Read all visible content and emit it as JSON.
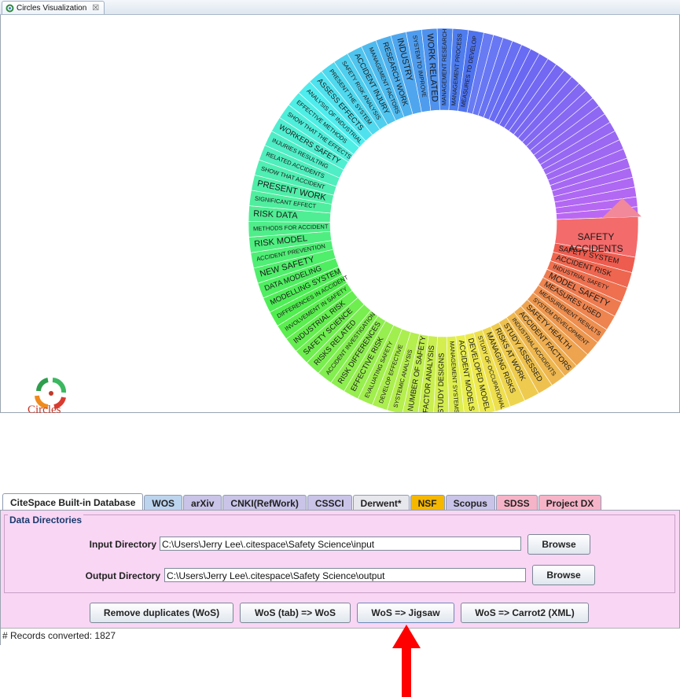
{
  "viz_window": {
    "tab_title": "Circles Visualization",
    "tab_close": "☒",
    "logo_text": "Circles"
  },
  "circle": {
    "highlight_label": [
      "SAFETY",
      "ACCIDENTS"
    ],
    "highlight_color": "#f46b6b",
    "segments": [
      "SAFETY SYSTEM",
      "ACCIDENT RISK",
      "INDUSTRIAL SAFETY",
      "MODEL SAFETY",
      "MEASURES USED",
      "MEASUREMENT RESULTS",
      "SYSTEM DEVELOPMENT",
      "SAFETY HEALTH",
      "ACCIDENT FACTORS",
      "INDUSTRIAL ACCIDENTS",
      "STUDY ASSESSED",
      "RISKS AT WORK",
      "MANAGING RISKS",
      "STUDY OF OCCUPATIONAL",
      "DEVELOPED MODEL",
      "ACCIDENT MODELS",
      "MANAGEMENT SYSTEMS",
      "STUDY DESIGNS",
      "FACTOR ANALYSIS",
      "NUMBER OF SAFETY",
      "SYSTEMIC ANALYSIS",
      "DEVELOP EFFECTIVE",
      "EVALUATING SAFETY",
      "EFFECTIVE RISK",
      "RISK DIFFERENCES",
      "ACCIDENT INVESTIGATION",
      "RISKS RELATED",
      "SAFETY SCIENCE",
      "INDUSTRIAL RISK",
      "INVOLVEMENT IN SAFETY",
      "DIFFERENCES IN ACCIDENT",
      "MODELLING SYSTEM",
      "DATA MODELING",
      "NEW SAFETY",
      "ACCIDENT PREVENTION",
      "RISK MODEL",
      "METHODS FOR ACCIDENT",
      "RISK DATA",
      "SIGNIFICANT EFFECT",
      "PRESENT WORK",
      "SHOW THAT ACCIDENT",
      "RELATED ACCIDENTS",
      "INJURIES RESULTING",
      "WORKERS SAFETY",
      "SHOW THAT THE EFFECTS",
      "EFFECTIVE METHODS",
      "ANALYSIS OF INDUSTRIAL",
      "ASSESS EFFECTS",
      "PRESENT THE SYSTEM",
      "SAFETY RISK ANALYSIS",
      "ACCIDENT INJURY",
      "MANAGEMENT FACTORS",
      "RESEARCH WORK",
      "INDUSTRY",
      "SYSTEM TO IMPROVE",
      "WORK RELATED",
      "MANAGEMENT RESEARCH",
      "MANAGEMENT PROCESS",
      "MEASURES TO DEVELOP"
    ]
  },
  "citespace": {
    "tabs": [
      {
        "label": "CiteSpace Built-in Database",
        "color": "#ffffff",
        "active": true
      },
      {
        "label": "WOS",
        "color": "#bcd4ee"
      },
      {
        "label": "arXiv",
        "color": "#c9c4e8"
      },
      {
        "label": "CNKI(RefWork)",
        "color": "#c9c4e8"
      },
      {
        "label": "CSSCI",
        "color": "#c9c4e8"
      },
      {
        "label": "Derwent*",
        "color": "#e7e7ee"
      },
      {
        "label": "NSF",
        "color": "#f5b700"
      },
      {
        "label": "Scopus",
        "color": "#c9c4e8"
      },
      {
        "label": "SDSS",
        "color": "#f6b4c8"
      },
      {
        "label": "Project DX",
        "color": "#f6b4c8"
      }
    ],
    "group_title": "Data Directories",
    "input_label": "Input Directory",
    "input_value": "C:\\Users\\Jerry Lee\\.citespace\\Safety Science\\input",
    "output_label": "Output Directory",
    "output_value": "C:\\Users\\Jerry Lee\\.citespace\\Safety Science\\output",
    "browse_label": "Browse",
    "buttons": [
      "Remove duplicates (WoS)",
      "WoS (tab) => WoS",
      "WoS => Jigsaw",
      "WoS => Carrot2 (XML)"
    ],
    "log_text": "# Records converted: 1827"
  },
  "annotation_arrow_color": "#ff0000"
}
